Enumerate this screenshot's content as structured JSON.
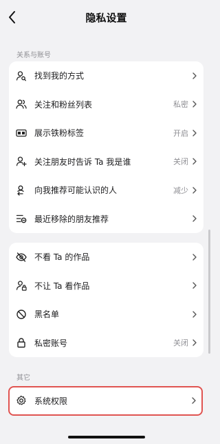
{
  "header": {
    "title": "隐私设置",
    "back_icon": "chevron-left-icon"
  },
  "sections": {
    "relations": {
      "title": "关系与账号",
      "items": [
        {
          "label": "找到我的方式",
          "value": "",
          "icon": "person-search-icon"
        },
        {
          "label": "关注和粉丝列表",
          "value": "私密",
          "icon": "people-icon"
        },
        {
          "label": "展示铁粉标签",
          "value": "开启",
          "icon": "fan-badge-icon"
        },
        {
          "label": "关注朋友时告诉 Ta 我是谁",
          "value": "关闭",
          "icon": "person-add-icon"
        },
        {
          "label": "向我推荐可能认识的人",
          "value": "减少",
          "icon": "person-recommend-icon"
        },
        {
          "label": "最近移除的朋友推荐",
          "value": "",
          "icon": "list-remove-icon"
        }
      ]
    },
    "content": {
      "items": [
        {
          "label": "不看 Ta 的作品",
          "value": "",
          "icon": "eye-off-icon"
        },
        {
          "label": "不让 Ta 看作品",
          "value": "",
          "icon": "person-lock-icon"
        },
        {
          "label": "黑名单",
          "value": "",
          "icon": "blocked-icon"
        },
        {
          "label": "私密账号",
          "value": "关闭",
          "icon": "lock-icon"
        }
      ]
    },
    "other": {
      "title": "其它",
      "items": [
        {
          "label": "系统权限",
          "value": "",
          "icon": "gear-icon"
        }
      ]
    }
  },
  "colors": {
    "background": "#f2f2f4",
    "card": "#ffffff",
    "highlight_border": "#e05350",
    "secondary_text": "#8e8e93"
  }
}
